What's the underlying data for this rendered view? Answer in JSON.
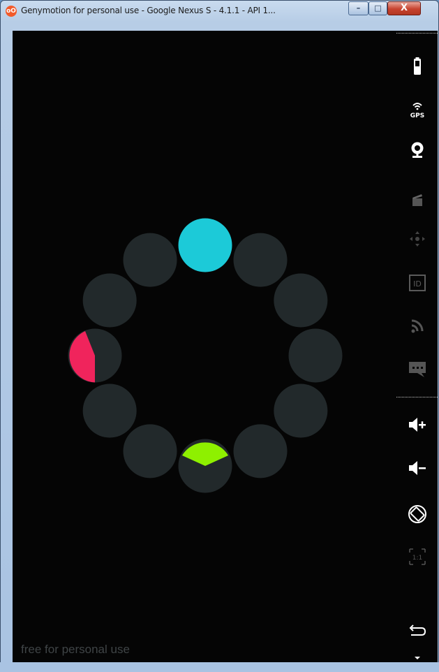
{
  "window": {
    "title": "Genymotion for personal use - Google Nexus S - 4.1.1 - API 1...",
    "app_icon_label": "oO",
    "buttons": {
      "minimize": "–",
      "maximize": "□",
      "close": "X"
    }
  },
  "screen": {
    "watermark": "free for personal use",
    "spinner": {
      "dot_color": "#22292b",
      "dot_count": 12,
      "highlights": [
        {
          "index": 0,
          "color": "#1ccad8",
          "fill": "full"
        },
        {
          "index": 9,
          "color": "#f0245c",
          "fill": "partial"
        },
        {
          "index": 6,
          "color": "#8ef000",
          "fill": "partial"
        }
      ]
    }
  },
  "sidebar": {
    "tools": [
      {
        "name": "battery-icon",
        "enabled": true
      },
      {
        "name": "gps-icon",
        "label": "GPS",
        "enabled": true
      },
      {
        "name": "camera-icon",
        "enabled": true
      },
      {
        "name": "capture-icon",
        "enabled": false
      },
      {
        "name": "dpad-icon",
        "enabled": false
      },
      {
        "name": "device-id-icon",
        "label": "ID",
        "enabled": false
      },
      {
        "name": "network-icon",
        "enabled": false
      },
      {
        "name": "sms-icon",
        "enabled": false
      },
      {
        "name": "volume-up-icon",
        "enabled": true
      },
      {
        "name": "volume-down-icon",
        "enabled": true
      },
      {
        "name": "rotate-icon",
        "enabled": true
      },
      {
        "name": "pixel-perfect-icon",
        "label": "1:1",
        "enabled": false
      },
      {
        "name": "back-icon",
        "enabled": true
      }
    ]
  }
}
